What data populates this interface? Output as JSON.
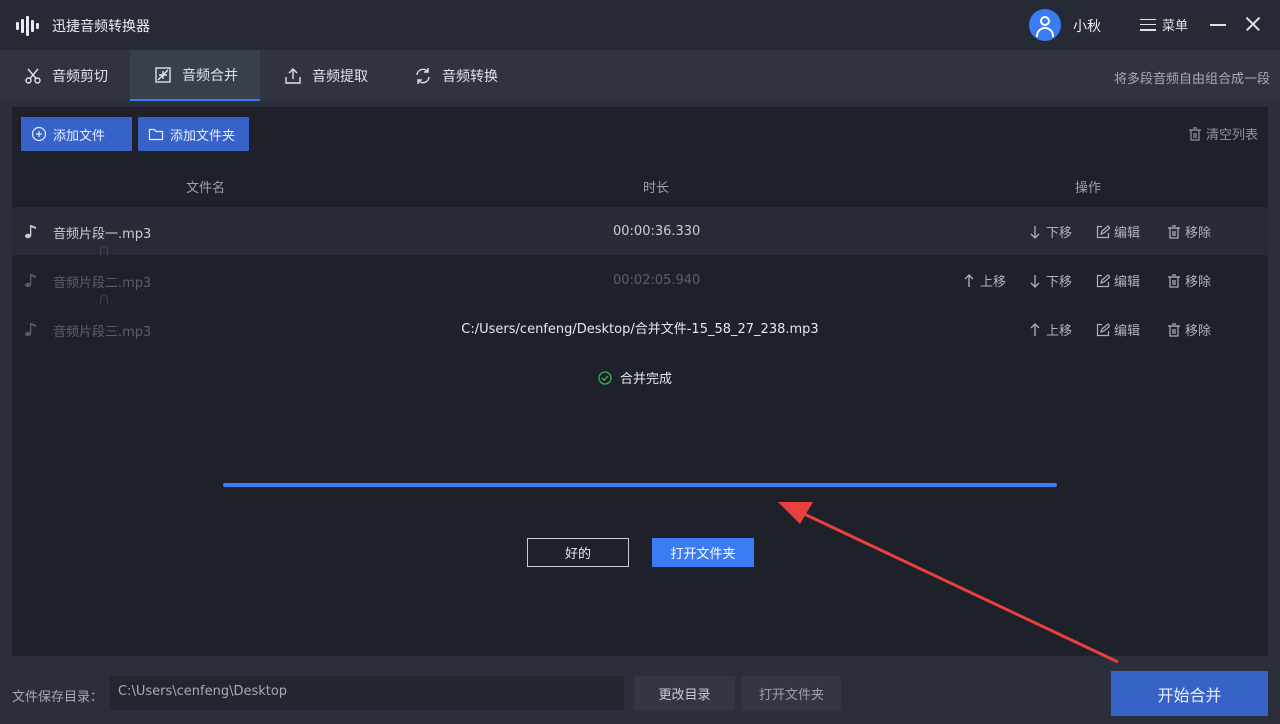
{
  "app": {
    "title": "迅捷音频转换器",
    "username": "小秋",
    "menu_label": "菜单"
  },
  "tabs": [
    {
      "label": "音频剪切",
      "icon": "scissors-icon"
    },
    {
      "label": "音频合并",
      "icon": "merge-icon",
      "active": true
    },
    {
      "label": "音频提取",
      "icon": "extract-icon"
    },
    {
      "label": "音频转换",
      "icon": "convert-icon"
    }
  ],
  "tab_hint": "将多段音频自由组合成一段",
  "toolbar": {
    "add_file": "添加文件",
    "add_folder": "添加文件夹",
    "clear_list": "清空列表"
  },
  "table": {
    "headers": {
      "filename": "文件名",
      "duration": "时长",
      "actions": "操作"
    },
    "rows": [
      {
        "name": "音频片段一.mp3",
        "duration": "00:00:36.330"
      },
      {
        "name": "音频片段二.mp3",
        "duration": "00:02:05.940"
      },
      {
        "name": "音频片段三.mp3",
        "duration": ""
      }
    ],
    "actions": {
      "up": "上移",
      "down": "下移",
      "edit": "编辑",
      "remove": "移除"
    }
  },
  "dialog": {
    "output_path": "C:/Users/cenfeng/Desktop/合并文件-15_58_27_238.mp3",
    "status": "合并完成",
    "progress": 1.0,
    "ok_label": "好的",
    "open_folder_label": "打开文件夹"
  },
  "bottom": {
    "save_dir_label": "文件保存目录：",
    "save_dir_value": "C:\\Users\\cenfeng\\Desktop",
    "change_dir": "更改目录",
    "open_folder": "打开文件夹",
    "start": "开始合并"
  },
  "colors": {
    "accent": "#3b7cf6",
    "button_blue": "#3763c9",
    "success": "#35b55a",
    "annotation": "#e8403c"
  }
}
